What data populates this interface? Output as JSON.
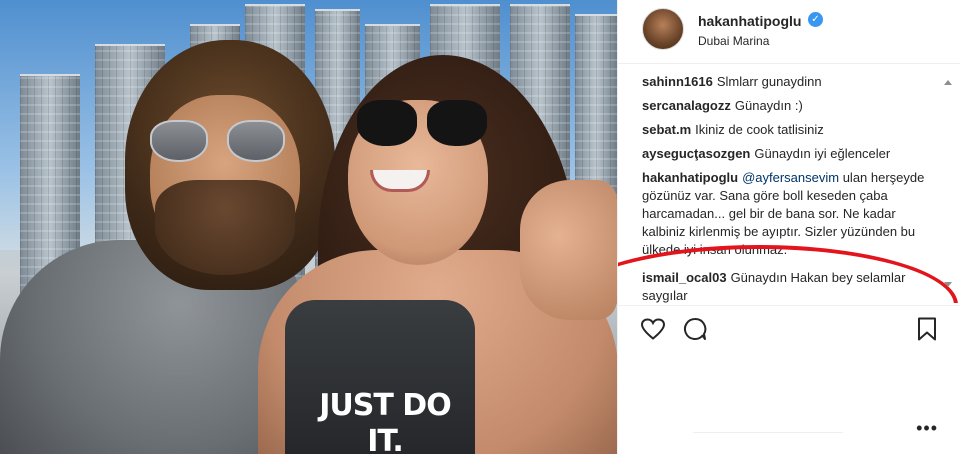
{
  "post": {
    "username": "hakanhatipoglu",
    "location": "Dubai Marina",
    "shirt_text": "JUST DO IT."
  },
  "comments": [
    {
      "author": "sahinn1616",
      "text": "Slmlarr gunaydinn"
    },
    {
      "author": "sercanalagozz",
      "text": "Günaydın :)"
    },
    {
      "author": "sebat.m",
      "text": "Ikiniz de cook tatlisiniz"
    },
    {
      "author": "aysegucţasozgen",
      "text": "Günaydın iyi eğlenceler"
    },
    {
      "author": "hakanhatipoglu",
      "mention": "@ayfersansevim",
      "text": "ulan herşeyde gözünüz var. Sana göre boll keseden çaba harcamadan... gel bir de bana sor. Ne kadar kalbiniz kirlenmiş be ayıptır. Sizler yüzünden bu ülkede iyi insan olunmaz."
    },
    {
      "author": "ismail_ocal03",
      "text": "Günaydın Hakan bey selamlar saygılar"
    }
  ],
  "icons": {
    "verified": "verified-badge-icon",
    "like": "heart-icon",
    "comment": "comment-bubble-icon",
    "save": "bookmark-icon",
    "more": "more-options-icon"
  },
  "more_label": "•••",
  "colors": {
    "verified": "#3897f0",
    "circle": "#e3141b",
    "mention": "#003569"
  }
}
